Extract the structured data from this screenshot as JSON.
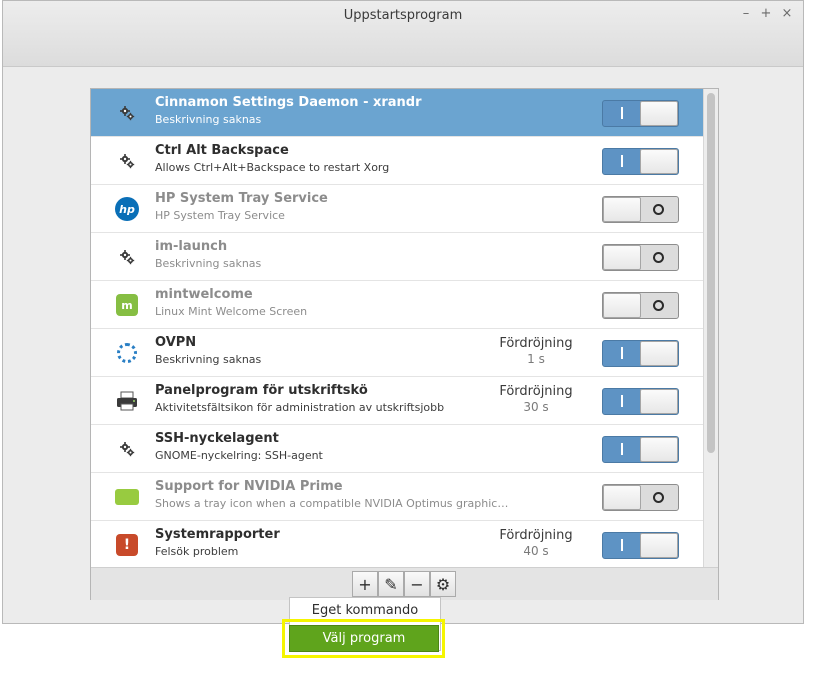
{
  "window": {
    "title": "Uppstartsprogram",
    "controls": {
      "minimize": "–",
      "maximize": "+",
      "close": "×"
    }
  },
  "rows": [
    {
      "name": "Cinnamon Settings Daemon - xrandr",
      "desc": "Beskrivning saknas",
      "icon": "gear-icon",
      "enabled": true,
      "selected": true
    },
    {
      "name": "Ctrl Alt Backspace",
      "desc": "Allows Ctrl+Alt+Backspace to restart Xorg",
      "icon": "gear-icon",
      "enabled": true
    },
    {
      "name": "HP System Tray Service",
      "desc": "HP System Tray Service",
      "icon": "hp-icon",
      "icon_text": "hp",
      "enabled": false
    },
    {
      "name": "im-launch",
      "desc": "Beskrivning saknas",
      "icon": "gear-icon",
      "enabled": false
    },
    {
      "name": "mintwelcome",
      "desc": "Linux Mint Welcome Screen",
      "icon": "mint-icon",
      "icon_text": "m",
      "enabled": false
    },
    {
      "name": "OVPN",
      "desc": "Beskrivning saknas",
      "icon": "ovpn-icon",
      "enabled": true,
      "delay_label": "Fördröjning",
      "delay_value": "1 s"
    },
    {
      "name": "Panelprogram för utskriftskö",
      "desc": "Aktivitetsfältsikon för administration av utskriftsjobb",
      "icon": "printer-icon",
      "enabled": true,
      "delay_label": "Fördröjning",
      "delay_value": "30 s"
    },
    {
      "name": "SSH-nyckelagent",
      "desc": "GNOME-nyckelring: SSH-agent",
      "icon": "gear-icon",
      "enabled": true
    },
    {
      "name": "Support for NVIDIA Prime",
      "desc": "Shows a tray icon when a compatible NVIDIA Optimus graphic…",
      "icon": "nvidia-icon",
      "enabled": false
    },
    {
      "name": "Systemrapporter",
      "desc": "Felsök problem",
      "icon": "warning-icon",
      "icon_text": "!",
      "enabled": true,
      "delay_label": "Fördröjning",
      "delay_value": "40 s"
    }
  ],
  "toolbar": {
    "add": "+",
    "edit": "✎",
    "remove": "−",
    "settings": "⚙"
  },
  "menu": {
    "custom_command": "Eget kommando",
    "choose_app": "Välj program"
  },
  "colors": {
    "selected_row": "#6ba4d0",
    "switch_on": "#5e93c4",
    "menu_highlight": "#5fa41c",
    "annotation": "#f5f500"
  }
}
